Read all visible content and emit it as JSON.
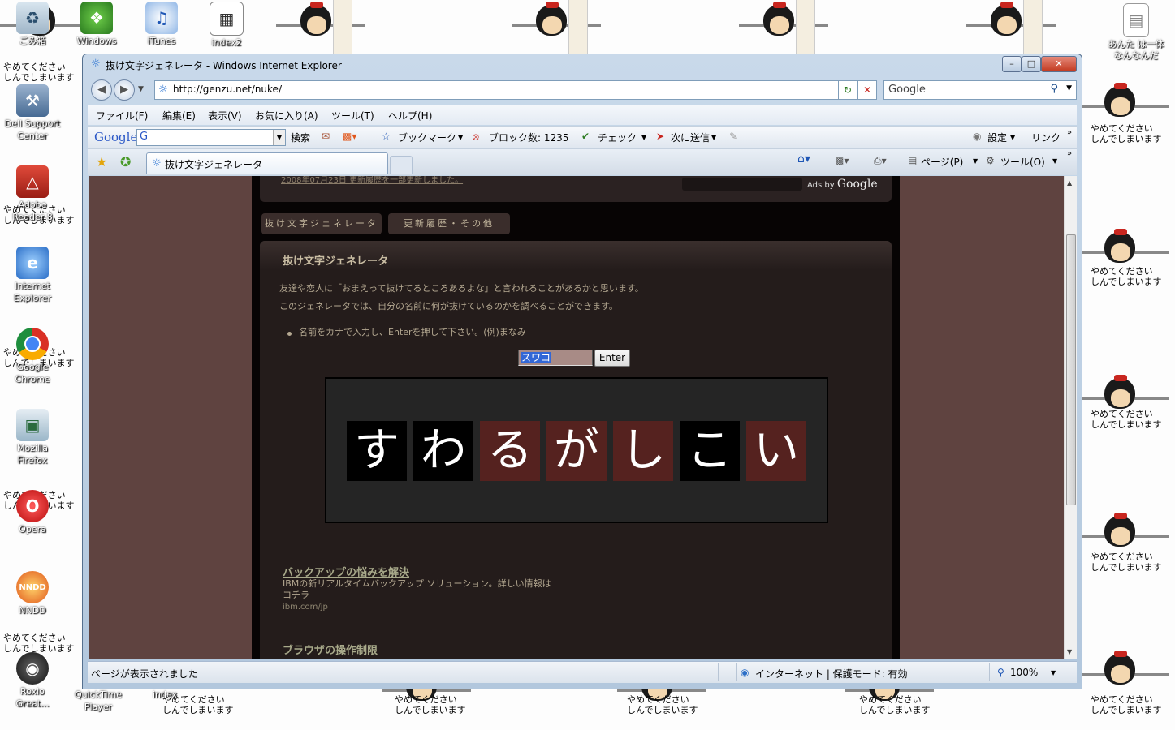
{
  "desktop": {
    "icons": [
      "ごみ箱",
      "Windows",
      "iTunes",
      "index2",
      "Dell Support",
      "Center",
      "Adobe",
      "Reader 8",
      "Internet",
      "Explorer",
      "Google",
      "Chrome",
      "Mozilla",
      "Firefox",
      "Opera",
      "NNDD",
      "Roxio",
      "Great...",
      "QuickTime",
      "Player",
      "index"
    ],
    "right_icon_label": [
      "あんた は一体",
      "なんなんだ"
    ],
    "wall_text": "やめてください\nしんでしまいます"
  },
  "window": {
    "title": "抜け文字ジェネレータ - Windows Internet Explorer",
    "address": "http://genzu.net/nuke/",
    "search_placeholder": "Google",
    "menu": [
      "ファイル(F)",
      "編集(E)",
      "表示(V)",
      "お気に入り(A)",
      "ツール(T)",
      "ヘルプ(H)"
    ],
    "google_bar": {
      "logo": "Google",
      "g": "G",
      "search_label": "検索",
      "bookmark": "ブックマーク",
      "blocked": "ブロック数: 1235",
      "check": "チェック",
      "send": "次に送信",
      "settings": "設定",
      "links": "リンク"
    },
    "tab_title": "抜け文字ジェネレータ",
    "commands": {
      "page": "ページ(P)",
      "tools": "ツール(O)"
    },
    "status": {
      "left": "ページが表示されました",
      "zone": "インターネット | 保護モード: 有効",
      "zoom": "100%"
    }
  },
  "page": {
    "top_link": "2008年07月23日 更新履歴を一部更新しました。",
    "ads_by": "Ads by",
    "ads_google": "Google",
    "nav": [
      "抜け文字ジェネレータ",
      "更新履歴・その他"
    ],
    "heading": "抜け文字ジェネレータ",
    "intro1": "友達や恋人に「おまえって抜けてるところあるよな」と言われることがあるかと思います。",
    "intro2": "このジェネレータでは、自分の名前に何が抜けているのかを調べることができます。",
    "instruction": "名前をカナで入力し、Enterを押して下さい。(例)まなみ",
    "input_value": "スワコ",
    "enter_label": "Enter",
    "result_chars": [
      "す",
      "わ",
      "る",
      "が",
      "し",
      "こ",
      "い"
    ],
    "ads": [
      {
        "title": "バックアップの悩みを解決",
        "desc": "IBMの新リアルタイムバックアップ ソリューション。詳しい情報はコチラ",
        "url": "ibm.com/jp"
      },
      {
        "title": "ブラウザの操作制限",
        "desc": "",
        "url": ""
      }
    ]
  }
}
